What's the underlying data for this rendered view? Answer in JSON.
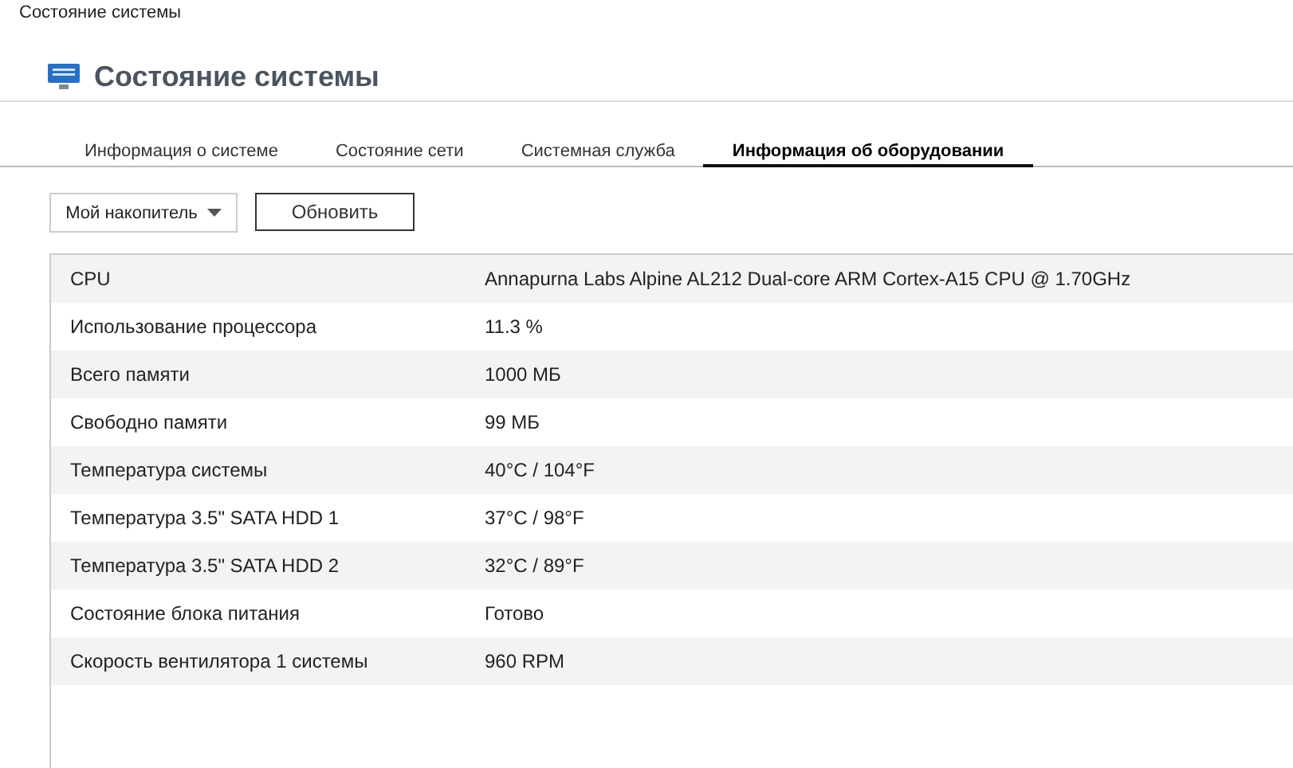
{
  "window": {
    "title": "Состояние системы"
  },
  "header": {
    "title": "Состояние системы"
  },
  "tabs": [
    {
      "label": "Информация о системе",
      "selected": false
    },
    {
      "label": "Состояние сети",
      "selected": false
    },
    {
      "label": "Системная служба",
      "selected": false
    },
    {
      "label": "Информация об оборудовании",
      "selected": true
    }
  ],
  "toolbar": {
    "dropdown": "Мой накопитель",
    "refresh_button": "Обновить"
  },
  "table": {
    "rows": [
      {
        "label": "CPU",
        "value": "Annapurna Labs Alpine AL212 Dual-core ARM Cortex-A15 CPU @ 1.70GHz"
      },
      {
        "label": "Использование процессора",
        "value": "11.3 %"
      },
      {
        "label": "Всего памяти",
        "value": "1000 МБ"
      },
      {
        "label": "Свободно памяти",
        "value": "99 МБ"
      },
      {
        "label": "Температура системы",
        "value": "40°C / 104°F"
      },
      {
        "label": "Температура 3.5\" SATA HDD 1",
        "value": "37°C / 98°F"
      },
      {
        "label": "Температура 3.5\" SATA HDD 2",
        "value": "32°C / 89°F"
      },
      {
        "label": "Состояние блока питания",
        "value": "Готово"
      },
      {
        "label": "Скорость вентилятора 1 системы",
        "value": "960 RPM"
      }
    ]
  }
}
